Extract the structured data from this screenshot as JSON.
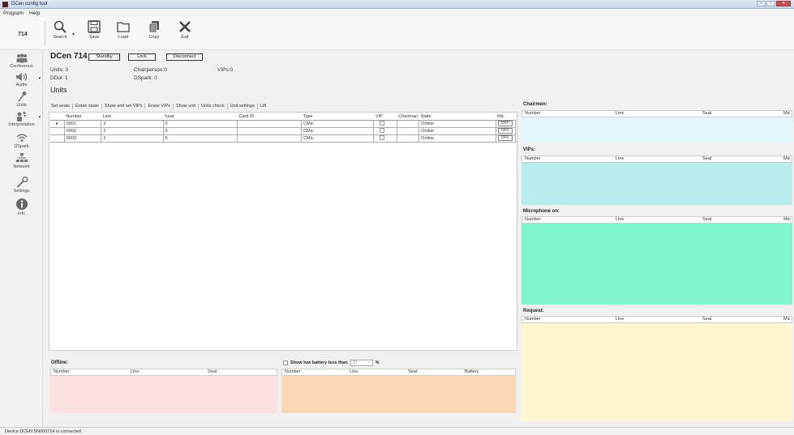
{
  "window": {
    "title": "DCen config tool",
    "controls": [
      "–",
      "▫",
      "✕"
    ]
  },
  "menu": {
    "items": [
      "Program",
      "Help"
    ]
  },
  "toolbar": {
    "device_number": "714",
    "buttons": [
      {
        "label": "Search",
        "icon": "search-icon"
      },
      {
        "label": "Save",
        "icon": "save-icon"
      },
      {
        "label": "Load",
        "icon": "folder-icon"
      },
      {
        "label": "Copy",
        "icon": "copy-icon"
      },
      {
        "label": "Exit",
        "icon": "close-icon"
      }
    ]
  },
  "sidebar": {
    "items": [
      {
        "label": "Conference",
        "icon": "people-icon"
      },
      {
        "label": "Audio",
        "icon": "speaker-icon"
      },
      {
        "label": "Units",
        "icon": "microphone-icon"
      },
      {
        "label": "Interpretation",
        "icon": "interpretation-icon"
      },
      {
        "label": "DSpark",
        "icon": "wireless-icon"
      },
      {
        "label": "Network",
        "icon": "network-icon"
      },
      {
        "label": "Settings",
        "icon": "wrench-icon"
      },
      {
        "label": "Info",
        "icon": "info-icon"
      }
    ]
  },
  "header": {
    "device_title": "DCen 714",
    "buttons": {
      "standby": "Standby",
      "lock": "Lock",
      "disconnect": "Disconnect"
    },
    "stats": {
      "units": "Units: 3",
      "ddol": "DDol: 1",
      "chairperson": "Chairperson:0",
      "dspark": "DSpark: 0",
      "vips": "VIPs:0"
    },
    "section_title": "Units"
  },
  "tabs": [
    "Set seats",
    "Erase seats",
    "Show and set VIPs",
    "Erase VIPs",
    "Show unit",
    "Units check",
    "Unit settings",
    "Lift"
  ],
  "units_table": {
    "columns": [
      "Number",
      "Line",
      "Seat",
      "Card ID",
      "Type",
      "VIP",
      "Chairman",
      "State",
      "Mic"
    ],
    "rows": [
      {
        "number": "0001",
        "line": "2",
        "seat": "0",
        "card_id": "",
        "type": "CMic",
        "state": "Online",
        "mic": "OFF"
      },
      {
        "number": "0002",
        "line": "2",
        "seat": "0",
        "card_id": "",
        "type": "CMic",
        "state": "Online",
        "mic": "OFF"
      },
      {
        "number": "0003",
        "line": "2",
        "seat": "0",
        "card_id": "",
        "type": "CMic",
        "state": "Online",
        "mic": "OFF"
      }
    ]
  },
  "offline": {
    "title": "Offline:",
    "columns": [
      "Number",
      "Line",
      "Seat"
    ],
    "color": "#fde0e0"
  },
  "battery": {
    "checkbox_label": "Show low battery less than",
    "value": "20",
    "unit": "%",
    "columns": [
      "Number",
      "Line",
      "Seat",
      "Battery"
    ],
    "color": "#fbd8b4"
  },
  "right_panels": {
    "chairmen": {
      "title": "Chairmen:",
      "columns": [
        "Number",
        "Line",
        "Seat",
        "Mic"
      ],
      "color": "#e2f7fb"
    },
    "vips": {
      "title": "VIPs:",
      "columns": [
        "Number",
        "Line",
        "Seat",
        "Mic"
      ],
      "color": "#b8ecec"
    },
    "mic_on": {
      "title": "Microphone on:",
      "columns": [
        "Number",
        "Line",
        "Seat",
        "Mic"
      ],
      "color": "#7ff5cd"
    },
    "request": {
      "title": "Request:",
      "columns": [
        "Number",
        "Line",
        "Seat",
        "Mic"
      ],
      "color": "#fdf6cf"
    }
  },
  "statusbar": {
    "text": "Device DCEN SN000714 is connected"
  }
}
